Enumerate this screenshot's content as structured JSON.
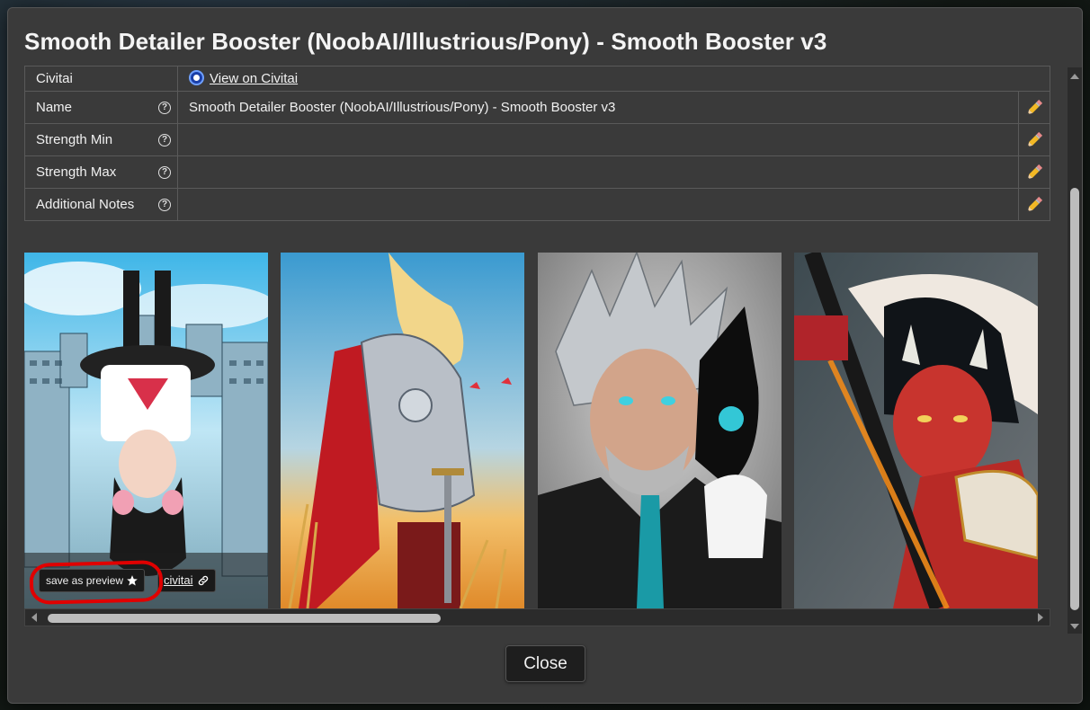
{
  "dialog": {
    "title": "Smooth Detailer Booster (NoobAI/Illustrious/Pony) - Smooth Booster v3",
    "close_label": "Close"
  },
  "info_rows": [
    {
      "label": "Civitai",
      "value": "View on Civitai",
      "has_help": false,
      "editable": false,
      "link": true
    },
    {
      "label": "Name",
      "value": "Smooth Detailer Booster (NoobAI/Illustrious/Pony) - Smooth Booster v3",
      "has_help": true,
      "editable": true
    },
    {
      "label": "Strength Min",
      "value": "",
      "has_help": true,
      "editable": true
    },
    {
      "label": "Strength Max",
      "value": "",
      "has_help": true,
      "editable": true
    },
    {
      "label": "Additional Notes",
      "value": "",
      "has_help": true,
      "editable": true
    }
  ],
  "help_glyph": "?",
  "gallery": {
    "save_preview_label": "save as preview",
    "civitai_link_label": "civitai",
    "images": [
      {
        "name": "upside-down-schoolgirl-city-image"
      },
      {
        "name": "armored-knight-wheat-field-image"
      },
      {
        "name": "silver-haired-man-suit-image"
      },
      {
        "name": "oni-samurai-katana-image"
      }
    ]
  },
  "icons": {
    "edit": "pencil-icon",
    "help": "help-icon",
    "star": "star-icon",
    "link": "link-icon",
    "civitai": "civitai-logo-icon"
  },
  "colors": {
    "dialog_bg": "#3a3a3a",
    "annotation_red": "#e00000",
    "civitai_blue": "#1a3fa8"
  }
}
